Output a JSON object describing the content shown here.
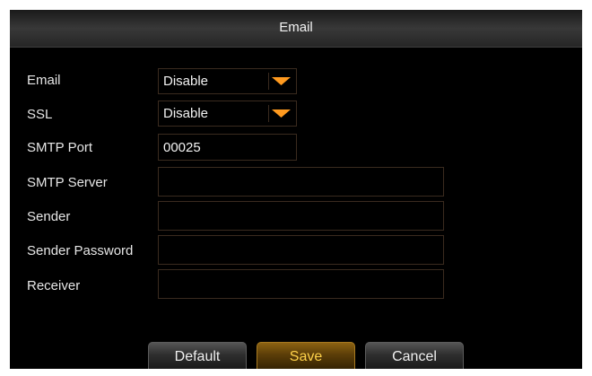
{
  "dialog": {
    "title": "Email"
  },
  "form": {
    "email_label": "Email",
    "email_value": "Disable",
    "ssl_label": "SSL",
    "ssl_value": "Disable",
    "smtp_port_label": "SMTP Port",
    "smtp_port_value": "00025",
    "smtp_server_label": "SMTP Server",
    "smtp_server_value": "",
    "sender_label": "Sender",
    "sender_value": "",
    "sender_password_label": "Sender Password",
    "sender_password_value": "",
    "receiver_label": "Receiver",
    "receiver_value": ""
  },
  "buttons": {
    "default_label": "Default",
    "save_label": "Save",
    "cancel_label": "Cancel"
  },
  "icons": {
    "dropdown": "chevron-down-icon"
  },
  "colors": {
    "accent": "#ff9a1f",
    "field_border": "#3a2b1f",
    "save_text": "#ffd24a"
  }
}
